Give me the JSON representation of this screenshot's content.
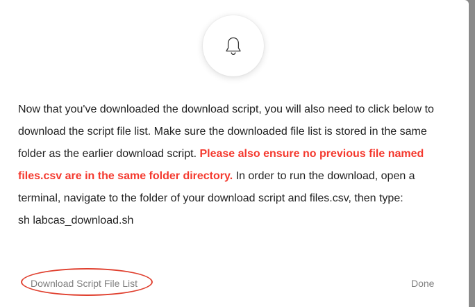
{
  "dialog": {
    "icon": "bell-icon",
    "message": {
      "part1": "Now that you've downloaded the download script, you will also need to click below to download the script file list. Make sure the downloaded file list is stored in the same folder as the earlier download script. ",
      "warning": "Please also ensure no previous file named files.csv are in the same folder directory.",
      "part2": " In order to run the download, open a terminal, navigate to the folder of your download script and files.csv, then type:",
      "command": "sh labcas_download.sh"
    },
    "buttons": {
      "download_label": "Download Script File List",
      "done_label": "Done"
    }
  },
  "colors": {
    "warning_text": "#f4392e",
    "annotation_ellipse": "#e0402f",
    "button_text": "#7f7f7f",
    "body_text": "#212121"
  }
}
